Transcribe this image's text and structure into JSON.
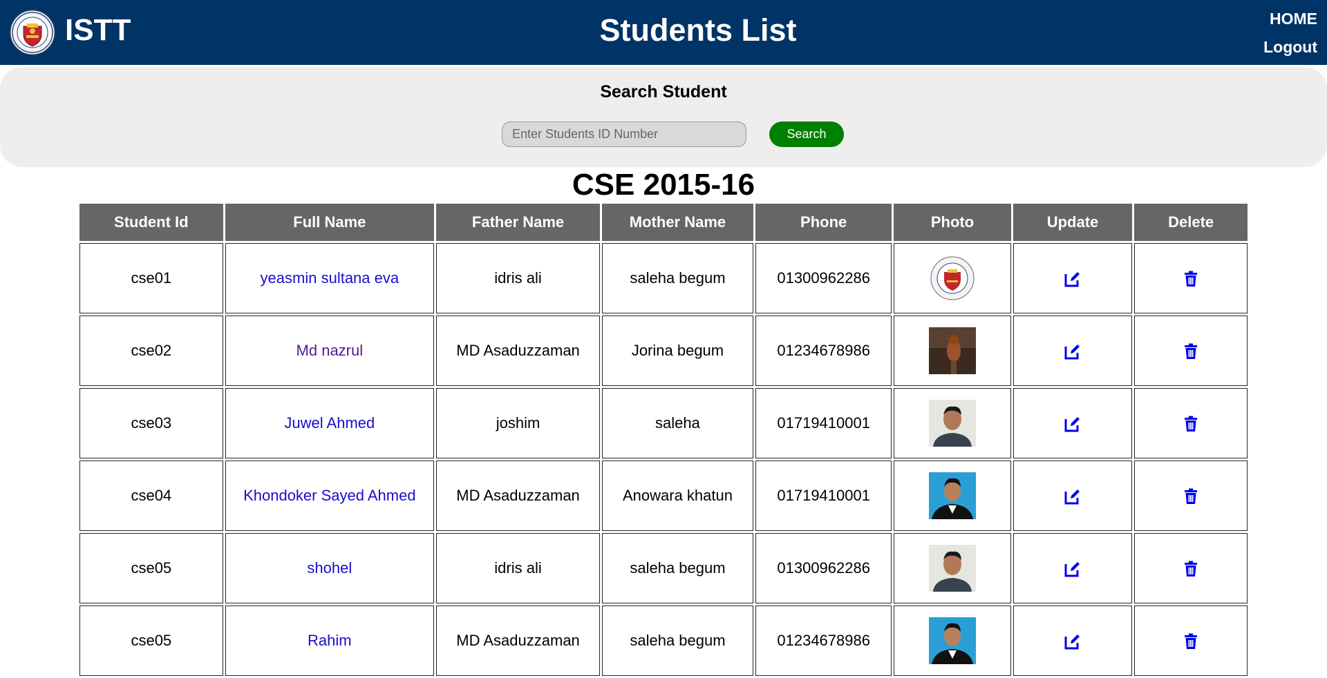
{
  "header": {
    "brand": "ISTT",
    "title": "Students List",
    "nav": {
      "home": "HOME",
      "logout": "Logout"
    }
  },
  "search": {
    "title": "Search Student",
    "placeholder": "Enter Students ID Number",
    "value": "",
    "button_label": "Search"
  },
  "section": {
    "title": "CSE 2015-16"
  },
  "table": {
    "columns": [
      "Student Id",
      "Full Name",
      "Father Name",
      "Mother Name",
      "Phone",
      "Photo",
      "Update",
      "Delete"
    ],
    "rows": [
      {
        "id": "cse01",
        "full_name": "yeasmin sultana eva",
        "father": "idris ali",
        "mother": "saleha begum",
        "phone": "01300962286",
        "photo": "institute-logo"
      },
      {
        "id": "cse02",
        "full_name": "Md nazrul",
        "father": "MD Asaduzzaman",
        "mother": "Jorina begum",
        "phone": "01234678986",
        "photo": "bird-photo"
      },
      {
        "id": "cse03",
        "full_name": "Juwel Ahmed",
        "father": "joshim",
        "mother": "saleha",
        "phone": "01719410001",
        "photo": "portrait-light-bg"
      },
      {
        "id": "cse04",
        "full_name": "Khondoker Sayed Ahmed",
        "father": "MD Asaduzzaman",
        "mother": "Anowara khatun",
        "phone": "01719410001",
        "photo": "portrait-blue-bg"
      },
      {
        "id": "cse05",
        "full_name": "shohel",
        "father": "idris ali",
        "mother": "saleha begum",
        "phone": "01300962286",
        "photo": "portrait-light-bg"
      },
      {
        "id": "cse05",
        "full_name": "Rahim",
        "father": "MD Asaduzzaman",
        "mother": "saleha begum",
        "phone": "01234678986",
        "photo": "portrait-blue-bg"
      }
    ]
  },
  "icons": {
    "update": "edit-icon",
    "delete": "trash-icon"
  },
  "colors": {
    "header_bg": "#003366",
    "search_button": "#008000",
    "table_header": "#666666",
    "link": "#1a0dcc",
    "visited_link": "#551a8b",
    "icon": "#0000ee"
  }
}
